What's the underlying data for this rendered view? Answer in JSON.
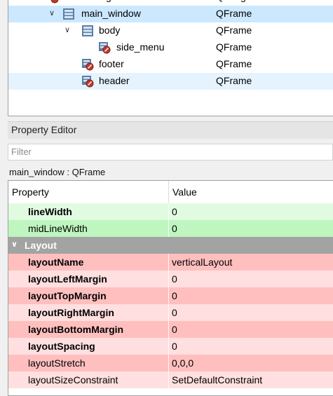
{
  "colors": {
    "selected_row": "#cce8ff",
    "hover_row": "#e5f3ff",
    "frame_green_dark": "#bff5bf",
    "frame_green_light": "#e1fbe1",
    "layout_group": "#a3a3a3",
    "layout_red_dark": "#ffbfbf",
    "layout_red_light": "#ffdfdf"
  },
  "object_tree": {
    "partial_top": {
      "name": "centralwidget",
      "class": "QWidget"
    },
    "rows": [
      {
        "name": "main_window",
        "class": "QFrame",
        "icon": "vertical-layout-icon",
        "expanded": true
      },
      {
        "name": "body",
        "class": "QFrame",
        "icon": "vertical-layout-icon",
        "expanded": true
      },
      {
        "name": "side_menu",
        "class": "QFrame",
        "icon": "broken-layout-icon"
      },
      {
        "name": "footer",
        "class": "QFrame",
        "icon": "broken-layout-icon"
      },
      {
        "name": "header",
        "class": "QFrame",
        "icon": "broken-layout-icon"
      }
    ]
  },
  "property_editor": {
    "title": "Property Editor",
    "filter_placeholder": "Filter",
    "object_label": "main_window : QFrame",
    "header": {
      "property": "Property",
      "value": "Value"
    },
    "frame_props": [
      {
        "name": "lineWidth",
        "value": "0",
        "bold": true
      },
      {
        "name": "midLineWidth",
        "value": "0",
        "bold": false
      }
    ],
    "layout_group": "Layout",
    "layout_props": [
      {
        "name": "layoutName",
        "value": "verticalLayout",
        "bold": true
      },
      {
        "name": "layoutLeftMargin",
        "value": "0",
        "bold": true
      },
      {
        "name": "layoutTopMargin",
        "value": "0",
        "bold": true
      },
      {
        "name": "layoutRightMargin",
        "value": "0",
        "bold": true
      },
      {
        "name": "layoutBottomMargin",
        "value": "0",
        "bold": true
      },
      {
        "name": "layoutSpacing",
        "value": "0",
        "bold": true
      },
      {
        "name": "layoutStretch",
        "value": "0,0,0",
        "bold": false
      },
      {
        "name": "layoutSizeConstraint",
        "value": "SetDefaultConstraint",
        "bold": false
      }
    ]
  }
}
